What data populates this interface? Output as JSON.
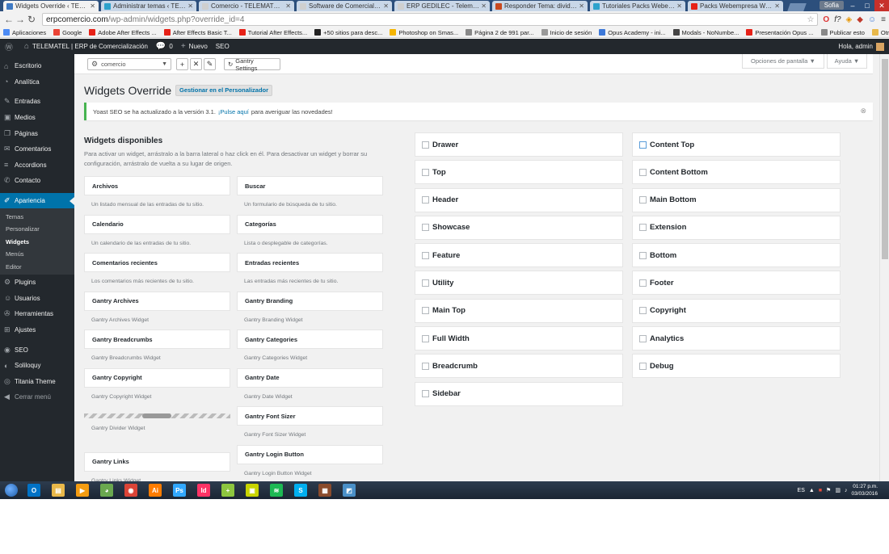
{
  "browser": {
    "tabs": [
      {
        "label": "Widgets Override ‹ TELEM",
        "color": "#3f7ac4",
        "active": true
      },
      {
        "label": "Administrar temas ‹ TELEM",
        "color": "#2ea2cc",
        "active": false
      },
      {
        "label": "Comercio - TELEMATEL | E",
        "color": "#cfcfcf",
        "active": false
      },
      {
        "label": "Software de Comercializac",
        "color": "#cfcfcf",
        "active": false
      },
      {
        "label": "ERP GEDILEC - Telematel",
        "color": "#cfcfcf",
        "active": false
      },
      {
        "label": "Responder Tema: dividir e",
        "color": "#c8491f",
        "active": false
      },
      {
        "label": "Tutoriales Packs Webemp",
        "color": "#2ea2cc",
        "active": false
      },
      {
        "label": "Packs Webempresa Word",
        "color": "#e62117",
        "active": false
      }
    ],
    "profile": "Sofia",
    "url_host": "erpcomercio.com",
    "url_path": "/wp-admin/widgets.php?override_id=4",
    "bookmarks": [
      {
        "label": "Aplicaciones",
        "color": "#4c8bf5"
      },
      {
        "label": "Google",
        "color": "#ea4335"
      },
      {
        "label": "Adobe After Effects ...",
        "color": "#e62117"
      },
      {
        "label": "After Effects Basic T...",
        "color": "#e62117"
      },
      {
        "label": "Tutorial After Effects...",
        "color": "#e62117"
      },
      {
        "label": "+50 sitios para desc...",
        "color": "#222222"
      },
      {
        "label": "Photoshop on Smas...",
        "color": "#f4b400"
      },
      {
        "label": "Página 2 de 991 par...",
        "color": "#888888"
      },
      {
        "label": "Inicio de sesión",
        "color": "#999999"
      },
      {
        "label": "Opus Academy - ini...",
        "color": "#3c78d8"
      },
      {
        "label": "Modals - NoNumbe...",
        "color": "#444444"
      },
      {
        "label": "Presentación Opus ...",
        "color": "#e62117"
      },
      {
        "label": "Publicar esto",
        "color": "#888888"
      }
    ],
    "other_bookmarks": "Otros marcadores"
  },
  "adminbar": {
    "site": "TELEMATEL | ERP de Comercialización",
    "comments": "0",
    "new": "Nuevo",
    "seo": "SEO",
    "howdy": "Hola, admin"
  },
  "sidebar": {
    "items_top": [
      {
        "label": "Escritorio",
        "icon": "⌂"
      },
      {
        "label": "Analítica",
        "icon": "◔"
      }
    ],
    "items_mid": [
      {
        "label": "Entradas",
        "icon": "✎"
      },
      {
        "label": "Medios",
        "icon": "▣"
      },
      {
        "label": "Páginas",
        "icon": "❐"
      },
      {
        "label": "Comentarios",
        "icon": "✉"
      },
      {
        "label": "Accordions",
        "icon": "≡"
      },
      {
        "label": "Contacto",
        "icon": "✆"
      }
    ],
    "current": {
      "label": "Apariencia",
      "icon": "✐"
    },
    "submenu": [
      "Temas",
      "Personalizar",
      "Widgets",
      "Menús",
      "Editor"
    ],
    "items_after": [
      {
        "label": "Plugins",
        "icon": "⚙"
      },
      {
        "label": "Usuarios",
        "icon": "☺"
      },
      {
        "label": "Herramientas",
        "icon": "✇"
      },
      {
        "label": "Ajustes",
        "icon": "⊞"
      }
    ],
    "items_bottom": [
      {
        "label": "SEO",
        "icon": "◉"
      },
      {
        "label": "Soliloquy",
        "icon": "◐"
      },
      {
        "label": "Titania Theme",
        "icon": "◎"
      }
    ],
    "collapse": "Cerrar menú"
  },
  "gantry": {
    "outline": "comercio",
    "settings": "Gantry Settings",
    "screen_options": "Opciones de pantalla ▼",
    "help": "Ayuda ▼"
  },
  "page": {
    "title": "Widgets Override",
    "action": "Gestionar en el Personalizador",
    "notice_pre": "Yoast SEO se ha actualizado a la versión 3.1.",
    "notice_link": "¡Pulse aquí",
    "notice_post": "para averiguar las novedades!",
    "available_title": "Widgets disponibles",
    "available_desc": "Para activar un widget, arrástralo a la barra lateral o haz click en él. Para desactivar un widget y borrar su configuración, arrástralo de vuelta a su lugar de origen."
  },
  "widgets_left": [
    {
      "name": "Archivos",
      "desc": "Un listado mensual de las entradas de tu sitio."
    },
    {
      "name": "Calendario",
      "desc": "Un calendario de las entradas de tu sitio."
    },
    {
      "name": "Comentarios recientes",
      "desc": "Los comentarios más recientes de tu sitio."
    },
    {
      "name": "Gantry Archives",
      "desc": "Gantry Archives Widget"
    },
    {
      "name": "Gantry Breadcrumbs",
      "desc": "Gantry Breadcrumbs Widget"
    },
    {
      "name": "Gantry Copyright",
      "desc": "Gantry Copyright Widget"
    }
  ],
  "widget_divider": {
    "desc": "Gantry Divider Widget"
  },
  "widget_links": {
    "name": "Gantry Links",
    "desc": "Gantry Links Widget"
  },
  "widgets_right": [
    {
      "name": "Buscar",
      "desc": "Un formulario de búsqueda de tu sitio."
    },
    {
      "name": "Categorías",
      "desc": "Lista o desplegable de categorías."
    },
    {
      "name": "Entradas recientes",
      "desc": "Las entradas más recientes de tu sitio."
    },
    {
      "name": "Gantry Branding",
      "desc": "Gantry Branding Widget"
    },
    {
      "name": "Gantry Categories",
      "desc": "Gantry Categories Widget"
    },
    {
      "name": "Gantry Date",
      "desc": "Gantry Date Widget"
    },
    {
      "name": "Gantry Font Sizer",
      "desc": "Gantry Font Sizer Widget"
    },
    {
      "name": "Gantry Login Button",
      "desc": "Gantry Login Button Widget"
    }
  ],
  "sidebars_left": [
    "Drawer",
    "Top",
    "Header",
    "Showcase",
    "Feature",
    "Utility",
    "Main Top",
    "Full Width",
    "Breadcrumb",
    "Sidebar"
  ],
  "sidebars_right": [
    "Content Top",
    "Content Bottom",
    "Main Bottom",
    "Extension",
    "Bottom",
    "Footer",
    "Copyright",
    "Analytics",
    "Debug"
  ],
  "taskbar": {
    "apps": [
      {
        "label": "O",
        "color": "#0072c6"
      },
      {
        "label": "▤",
        "color": "#e8b84a"
      },
      {
        "label": "▶",
        "color": "#f39c12"
      },
      {
        "label": "◕",
        "color": "#6aa84f"
      },
      {
        "label": "◉",
        "color": "#db4437"
      },
      {
        "label": "Ai",
        "color": "#ff7c00"
      },
      {
        "label": "Ps",
        "color": "#31a8ff"
      },
      {
        "label": "Id",
        "color": "#ff3366"
      },
      {
        "label": "+",
        "color": "#8dc63f"
      },
      {
        "label": "▣",
        "color": "#c8d400"
      },
      {
        "label": "≋",
        "color": "#1db954"
      },
      {
        "label": "S",
        "color": "#00aff0"
      },
      {
        "label": "▦",
        "color": "#8a4b2c"
      },
      {
        "label": "◩",
        "color": "#4a90c8"
      }
    ],
    "lang": "ES",
    "time": "01:27 p.m.",
    "date": "03/03/2016"
  }
}
